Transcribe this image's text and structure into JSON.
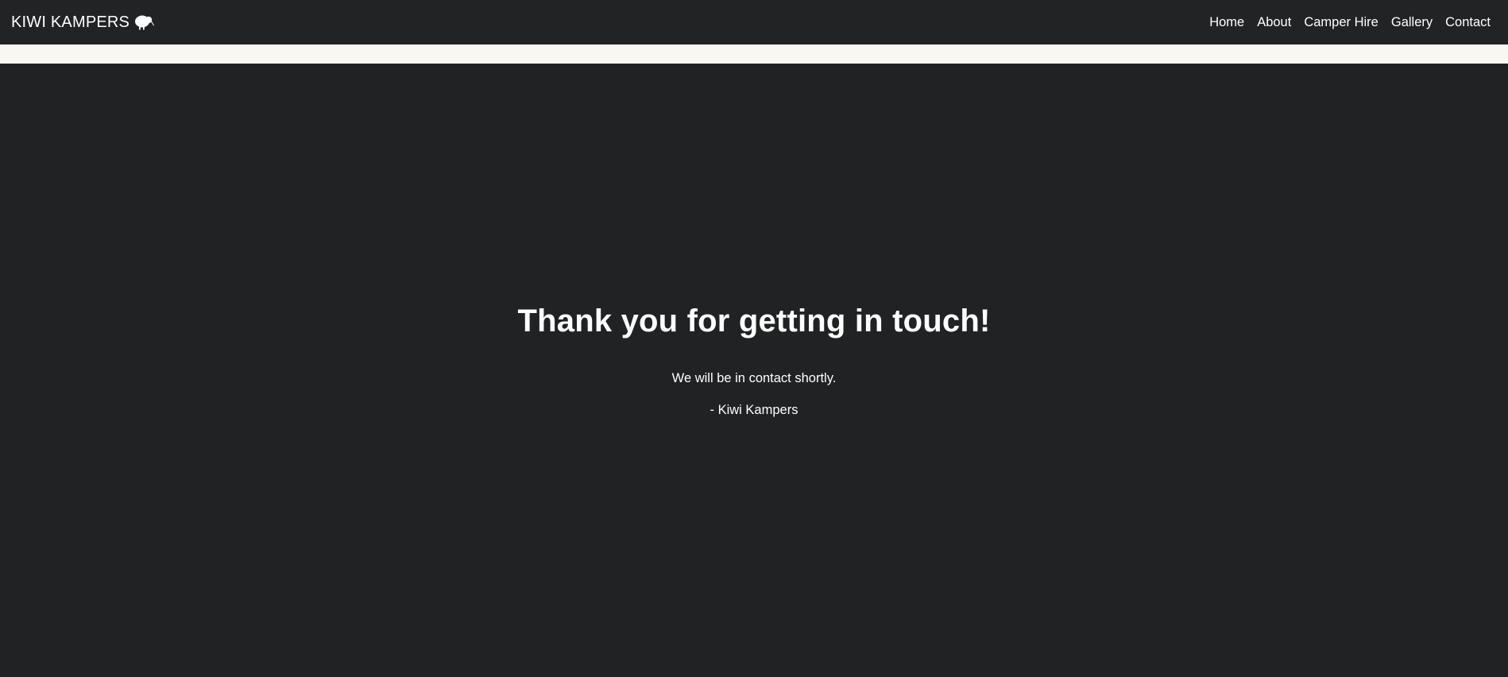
{
  "navbar": {
    "brand": "KIWI KAMPERS",
    "brand_icon": "kiwi-bird-icon",
    "links": [
      {
        "label": "Home"
      },
      {
        "label": "About"
      },
      {
        "label": "Camper Hire"
      },
      {
        "label": "Gallery"
      },
      {
        "label": "Contact"
      }
    ]
  },
  "main": {
    "heading": "Thank you for getting in touch!",
    "message": "We will be in contact shortly.",
    "signature": "- Kiwi Kampers"
  },
  "colors": {
    "background": "#212224",
    "navbar": "#222325",
    "stripe": "#f8f7f2",
    "text": "#ffffff"
  }
}
